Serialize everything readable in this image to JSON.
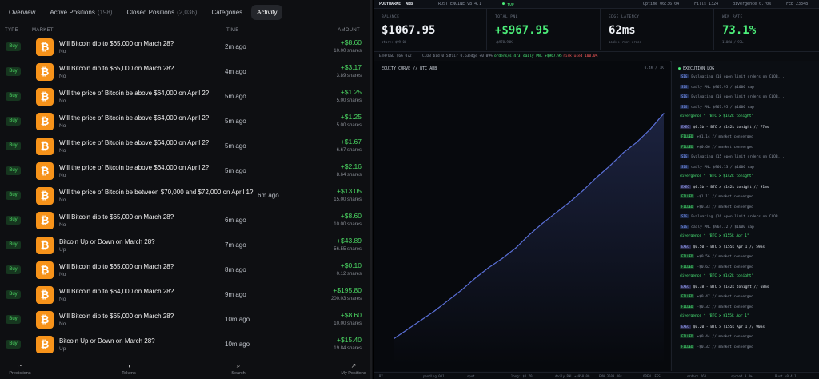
{
  "tabs": [
    {
      "label": "Overview",
      "count": ""
    },
    {
      "label": "Active Positions",
      "count": "(198)"
    },
    {
      "label": "Closed Positions",
      "count": "(2,036)"
    },
    {
      "label": "Categories",
      "count": ""
    },
    {
      "label": "Activity",
      "count": ""
    }
  ],
  "columns": {
    "type": "TYPE",
    "market": "MARKET",
    "time": "TIME",
    "amount": "AMOUNT"
  },
  "rows": [
    {
      "type": "Buy",
      "icon": "bitcoin-icon",
      "question": "Will Bitcoin dip to $65,000 on March 28?",
      "side": "No",
      "time": "2m ago",
      "amount": "+$8.60",
      "shares": "10.00 shares"
    },
    {
      "type": "Buy",
      "icon": "bitcoin-icon",
      "question": "Will Bitcoin dip to $65,000 on March 28?",
      "side": "No",
      "time": "4m ago",
      "amount": "+$3.17",
      "shares": "3.89 shares"
    },
    {
      "type": "Buy",
      "icon": "bitcoin-icon",
      "question": "Will the price of Bitcoin be above $64,000 on April 2?",
      "side": "No",
      "time": "5m ago",
      "amount": "+$1.25",
      "shares": "5.00 shares"
    },
    {
      "type": "Buy",
      "icon": "bitcoin-icon",
      "question": "Will the price of Bitcoin be above $64,000 on April 2?",
      "side": "No",
      "time": "5m ago",
      "amount": "+$1.25",
      "shares": "5.00 shares"
    },
    {
      "type": "Buy",
      "icon": "bitcoin-icon",
      "question": "Will the price of Bitcoin be above $64,000 on April 2?",
      "side": "No",
      "time": "5m ago",
      "amount": "+$1.67",
      "shares": "6.67 shares"
    },
    {
      "type": "Buy",
      "icon": "bitcoin-icon",
      "question": "Will the price of Bitcoin be above $64,000 on April 2?",
      "side": "No",
      "time": "5m ago",
      "amount": "+$2.16",
      "shares": "8.64 shares"
    },
    {
      "type": "Buy",
      "icon": "bitcoin-icon",
      "question": "Will the price of Bitcoin be between $70,000 and $72,000 on April 1?",
      "side": "No",
      "time": "6m ago",
      "amount": "+$13.05",
      "shares": "15.00 shares"
    },
    {
      "type": "Buy",
      "icon": "bitcoin-icon",
      "question": "Will Bitcoin dip to $65,000 on March 28?",
      "side": "No",
      "time": "6m ago",
      "amount": "+$8.60",
      "shares": "10.00 shares"
    },
    {
      "type": "Buy",
      "icon": "bitcoin-icon",
      "question": "Bitcoin Up or Down on March 28?",
      "side": "Up",
      "time": "7m ago",
      "amount": "+$43.89",
      "shares": "56.55 shares"
    },
    {
      "type": "Buy",
      "icon": "bitcoin-icon",
      "question": "Will Bitcoin dip to $65,000 on March 28?",
      "side": "No",
      "time": "8m ago",
      "amount": "+$0.10",
      "shares": "0.12 shares"
    },
    {
      "type": "Buy",
      "icon": "bitcoin-icon",
      "question": "Will Bitcoin dip to $64,000 on March 28?",
      "side": "No",
      "time": "9m ago",
      "amount": "+$195.80",
      "shares": "200.03 shares"
    },
    {
      "type": "Buy",
      "icon": "bitcoin-icon",
      "question": "Will Bitcoin dip to $65,000 on March 28?",
      "side": "No",
      "time": "10m ago",
      "amount": "+$8.60",
      "shares": "10.00 shares"
    },
    {
      "type": "Buy",
      "icon": "bitcoin-icon",
      "question": "Bitcoin Up or Down on March 28?",
      "side": "Up",
      "time": "10m ago",
      "amount": "+$15.40",
      "shares": "19.84 shares"
    }
  ],
  "bottom_nav": [
    {
      "label": "Predictions",
      "icon": "pie-chart-icon"
    },
    {
      "label": "Tokens",
      "icon": "token-icon"
    },
    {
      "label": "Search",
      "icon": "search-icon"
    },
    {
      "label": "My Positions",
      "icon": "trend-icon"
    }
  ],
  "bot": {
    "header": {
      "name": "POLYMARKET ARB",
      "version": "RUST ENGINE v8.4.1",
      "status": "LIVE",
      "uptime": "Uptime 06:36:04",
      "fills": "Fills 1324",
      "divergence": "divergence 0.70%",
      "fee": "FEE 23348"
    },
    "stats": [
      {
        "label": "BALANCE",
        "value": "$1067.95",
        "sub": "start: $99.00",
        "color": "#eef1f5"
      },
      {
        "label": "TOTAL PNL",
        "value": "+$967.95",
        "sub": "+$978.90K",
        "color": "#4cf07a"
      },
      {
        "label": "EDGE LATENCY",
        "value": "62ms",
        "sub": "book > rust order",
        "color": "#eef1f5"
      },
      {
        "label": "WIN RATE",
        "value": "73.1%",
        "sub": "1106W / 97L",
        "color": "#4cf07a"
      }
    ],
    "stats_line": [
      "ETH/USD $66 072",
      "CLOB bid 0.54",
      "fair 0.63",
      "edge +0.09%",
      "orders/s 473",
      "daily PNL +$967.95",
      "risk used 100.0%"
    ],
    "chart_title": "EQUITY CURVE // BTC ARB",
    "chart_right": "0.4K / 1K",
    "log_title": "EXECUTION LOG",
    "status_bar": [
      "RX",
      "pending 001",
      "spot",
      "long: $1.70",
      "daily PNL +$950.00",
      "EMA 3600 40s",
      "OPEN LEGS",
      "orders 263",
      "spread 0.4%",
      "Rust v0.4.1"
    ]
  },
  "chart_data": {
    "type": "line",
    "title": "EQUITY CURVE // BTC ARB",
    "xlabel": "",
    "ylabel": "",
    "x": [
      0,
      5,
      10,
      15,
      20,
      25,
      30,
      35,
      40,
      45,
      50,
      55,
      60,
      65,
      70,
      75,
      80,
      85,
      90,
      95,
      100
    ],
    "series": [
      {
        "name": "",
        "values": [
          100,
          135,
          170,
          205,
          245,
          285,
          330,
          370,
          405,
          445,
          495,
          540,
          580,
          620,
          665,
          715,
          760,
          810,
          850,
          900,
          960
        ]
      }
    ],
    "ylim": [
      0,
      1100
    ],
    "grid": false,
    "color": "#5a6fd6"
  },
  "log": [
    {
      "tag": "",
      "text": "EXECUTION LOG"
    },
    {
      "tag": "SIG",
      "text": "Evaluating (18 open limit orders on CLOB..."
    },
    {
      "tag": "SIG",
      "text": "daily PNL $967.95 / $1000 cap"
    },
    {
      "tag": "SIG",
      "text": "Evaluating (18 open limit orders on CLOB..."
    },
    {
      "tag": "SIG",
      "text": "daily PNL $967.95 / $1000 cap"
    },
    {
      "tag": "",
      "text": "divergence * \"BTC > $142k tonight\""
    },
    {
      "tag": "EXEC",
      "text": "$0.3b - BTC > $142k tonight // 77ms"
    },
    {
      "tag": "FILLED",
      "text": "+$1.14 // market converged"
    },
    {
      "tag": "FILLED",
      "text": "+$0.66 // market converged"
    },
    {
      "tag": "SIG",
      "text": "Evaluating (15 open limit orders on CLOB..."
    },
    {
      "tag": "SIG",
      "text": "daily PNL $966.13 / $1000 cap"
    },
    {
      "tag": "",
      "text": "divergence * \"BTC > $142k tonight\""
    },
    {
      "tag": "EXEC",
      "text": "$0.3b - BTC > $142k tonight // 91ms"
    },
    {
      "tag": "FILLED",
      "text": "-$1.11 // market converged"
    },
    {
      "tag": "FILLED",
      "text": "+$0.33 // market converged"
    },
    {
      "tag": "SIG",
      "text": "Evaluating (16 open limit orders on CLOB..."
    },
    {
      "tag": "SIG",
      "text": "daily PNL $964.72 / $1000 cap"
    },
    {
      "tag": "",
      "text": "divergence * \"BTC > $155k Apr 1\""
    },
    {
      "tag": "EXEC",
      "text": "$0.50 - BTC > $155k Apr 1 // 59ms"
    },
    {
      "tag": "FILLED",
      "text": "+$0.56 // market converged"
    },
    {
      "tag": "FILLED",
      "text": "-$0.62 // market converged"
    },
    {
      "tag": "",
      "text": "divergence * \"BTC > $142k tonight\""
    },
    {
      "tag": "EXEC",
      "text": "$0.38 - BTC > $142k tonight // 68ms"
    },
    {
      "tag": "FILLED",
      "text": "+$0.47 // market converged"
    },
    {
      "tag": "FILLED",
      "text": "-$0.32 // market converged"
    },
    {
      "tag": "",
      "text": "divergence * \"BTC > $155k Apr 1\""
    },
    {
      "tag": "EXEC",
      "text": "$0.20 - BTC > $155k Apr 1 // 90ms"
    },
    {
      "tag": "FILLED",
      "text": "+$0.44 // market converged"
    },
    {
      "tag": "FILLED",
      "text": "-$0.32 // market converged"
    }
  ],
  "colors": {
    "green": "#4cd964",
    "accent": "#f7931a",
    "panel": "#0e0f12"
  }
}
